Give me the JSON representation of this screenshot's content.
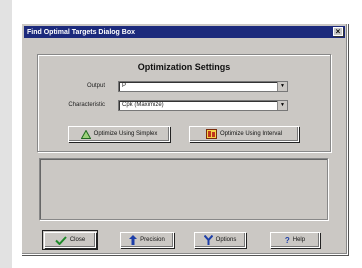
{
  "dialog": {
    "title": "Find Optimal Targets Dialog Box",
    "close_glyph": "×"
  },
  "settings": {
    "title": "Optimization Settings",
    "output_label": "Output",
    "output_value": "P",
    "characteristic_label": "Characteristic",
    "characteristic_value": "Cpk (Maximize)"
  },
  "actions": {
    "simplex_label": "Optimize Using Simplex",
    "interval_label": "Optimize Using Interval"
  },
  "footer": {
    "close_label": "Close",
    "precision_label": "Precision",
    "options_label": "Options",
    "help_label": "Help",
    "help_glyph": "?"
  },
  "icons": {
    "close": "checkmark-icon",
    "precision": "up-arrow-icon",
    "options": "y-icon",
    "help": "question-icon",
    "simplex": "triangle-icon",
    "interval": "interval-icon"
  },
  "colors": {
    "title_bar": "#1c2a7c",
    "window": "#cbc8c4",
    "icon_blue": "#1d3ea8",
    "check_green": "#1f8a2a"
  }
}
